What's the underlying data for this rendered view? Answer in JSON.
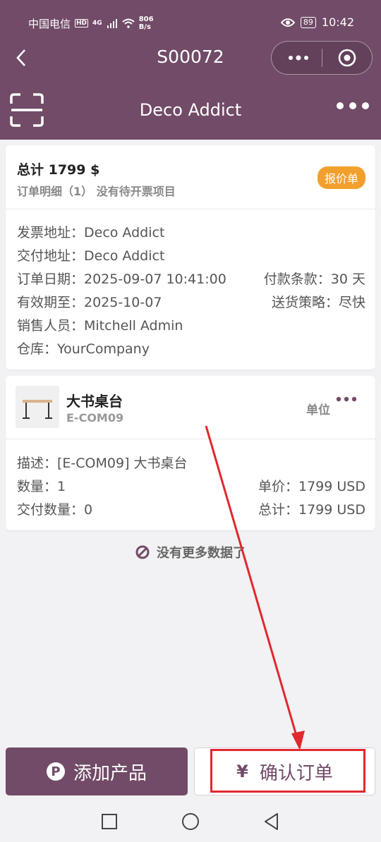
{
  "status": {
    "carrier": "中国电信",
    "hd": "HD",
    "net": "4G",
    "speed_value": "806",
    "speed_unit": "B/s",
    "battery": "89",
    "time": "10:42"
  },
  "nav": {
    "title": "S00072",
    "back_icon": "chevron-left-icon",
    "more_icon": "more-dots-icon",
    "target_icon": "target-icon"
  },
  "header": {
    "title": "Deco Addict",
    "scan_icon": "scan-icon",
    "more_icon": "more-dots-icon"
  },
  "order": {
    "total_label": "总计 1799 $",
    "subline": "订单明细（1） 没有待开票项目",
    "badge": "报价单",
    "invoice_address": "发票地址：Deco Addict",
    "delivery_address": "交付地址：Deco Addict",
    "order_date": "订单日期：2025-09-07 10:41:00",
    "payment_terms": "付款条款：30 天",
    "valid_until": "有效期至：2025-10-07",
    "shipping_policy": "送货策略：尽快",
    "salesperson": "销售人员：Mitchell Admin",
    "warehouse": "仓库：YourCompany"
  },
  "line": {
    "product_name": "大书桌台",
    "product_code": "E-COM09",
    "unit_label": "单位",
    "description": "描述：[E-COM09] 大书桌台",
    "quantity": "数量：1",
    "unit_price": "单价：1799 USD",
    "delivered_qty": "交付数量：0",
    "subtotal": "总计：1799 USD"
  },
  "list_end": "没有更多数据了",
  "actions": {
    "add_product": "添加产品",
    "add_icon_letter": "P",
    "confirm_order": "确认订单",
    "confirm_icon": "¥"
  },
  "colors": {
    "primary": "#714b67",
    "badge": "#f2a02d",
    "annotation": "#e0282e"
  }
}
